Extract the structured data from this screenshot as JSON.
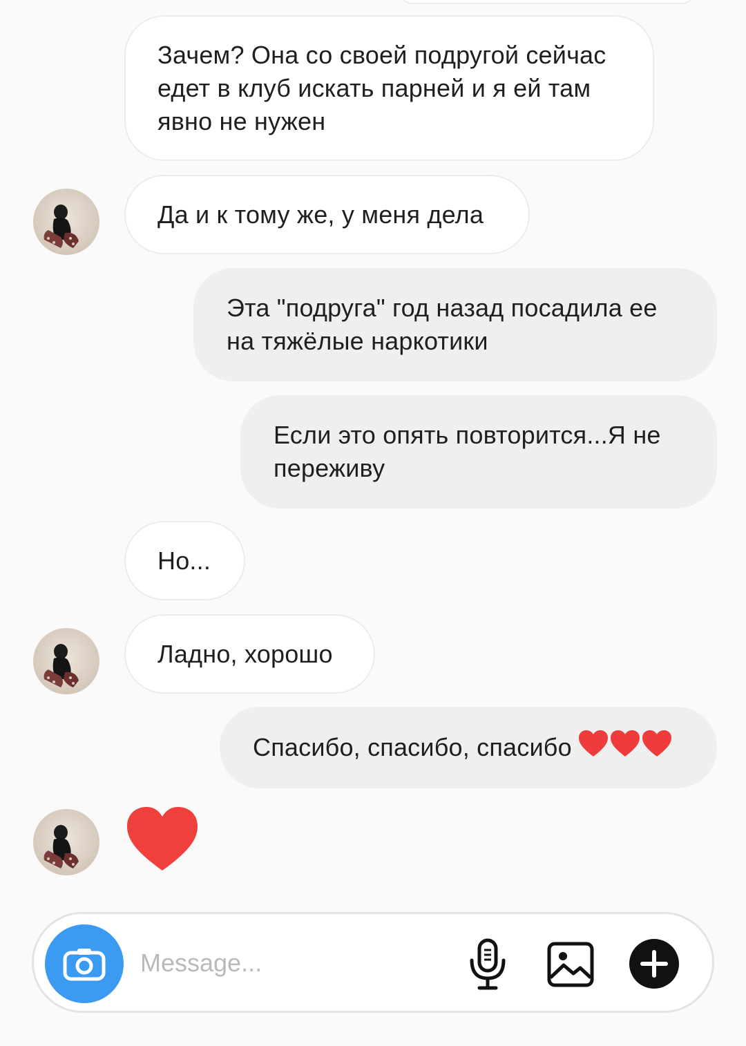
{
  "conversation": {
    "messages": [
      {
        "side": "in",
        "text": "Зачем? Она со своей подругой сейчас едет в клуб искать парней и я ей там явно не нужен"
      },
      {
        "side": "in",
        "text": "Да и к тому же, у меня дела",
        "avatar": true
      },
      {
        "side": "out",
        "text": "Эта \"подруга\" год назад посадила ее на тяжёлые наркотики"
      },
      {
        "side": "out",
        "text": "Если это опять повторится...Я не переживу"
      },
      {
        "side": "in",
        "text": "Но..."
      },
      {
        "side": "in",
        "text": "Ладно, хорошо",
        "avatar": true
      },
      {
        "side": "out",
        "text": "Спасибо, спасибо, спасибо",
        "emoji": "❤️❤️❤️"
      },
      {
        "side": "in",
        "type": "heart-reaction",
        "avatar": true
      }
    ]
  },
  "composer": {
    "placeholder": "Message...",
    "camera_icon": "camera-icon",
    "mic_icon": "microphone-icon",
    "gallery_icon": "image-icon",
    "add_icon": "plus-icon"
  },
  "colors": {
    "camera_button": "#3b9af2",
    "outgoing_bubble": "#efefef",
    "incoming_border": "#ececec",
    "heart": "#f0403d"
  }
}
